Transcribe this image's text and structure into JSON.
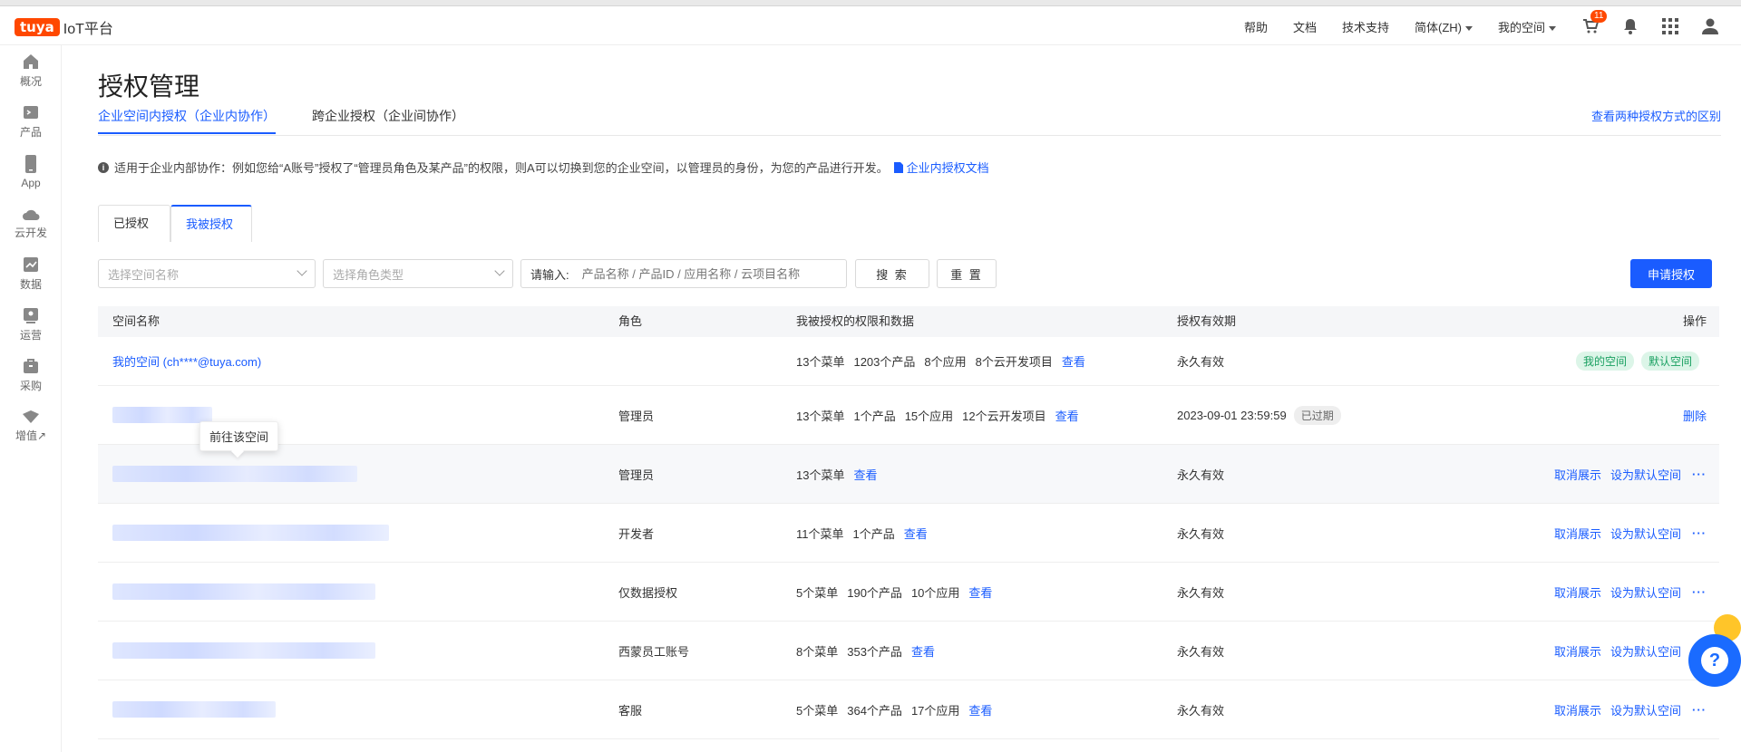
{
  "topbar": {
    "logo_badge": "tuya",
    "logo_text": "IoT平台",
    "nav": [
      "帮助",
      "文档",
      "技术支持",
      "简体(ZH)",
      "我的空间"
    ],
    "cart_count": "11"
  },
  "sidebar": {
    "items": [
      {
        "label": "概况",
        "icon": "home-icon"
      },
      {
        "label": "产品",
        "icon": "product-icon"
      },
      {
        "label": "App",
        "icon": "app-icon"
      },
      {
        "label": "云开发",
        "icon": "cloud-icon"
      },
      {
        "label": "数据",
        "icon": "chart-icon"
      },
      {
        "label": "运营",
        "icon": "operation-icon"
      },
      {
        "label": "采购",
        "icon": "purchase-icon"
      },
      {
        "label": "增值↗",
        "icon": "value-added-icon"
      }
    ]
  },
  "page": {
    "title": "授权管理",
    "tabs": [
      "企业空间内授权（企业内协作）",
      "跨企业授权（企业间协作）"
    ],
    "compare_link": "查看两种授权方式的区别",
    "notice": "适用于企业内部协作：例如您给“A账号”授权了“管理员角色及某产品”的权限，则A可以切换到您的企业空间，以管理员的身份，为您的产品进行开发。",
    "notice_link": "企业内授权文档",
    "subtabs": [
      "已授权",
      "我被授权"
    ]
  },
  "filters": {
    "space_placeholder": "选择空间名称",
    "role_placeholder": "选择角色类型",
    "input_label": "请输入:",
    "input_placeholder": "产品名称 / 产品ID / 应用名称 / 云项目名称",
    "search": "搜 索",
    "reset": "重 置",
    "apply": "申请授权"
  },
  "table": {
    "headers": [
      "空间名称",
      "角色",
      "我被授权的权限和数据",
      "授权有效期",
      "操作"
    ],
    "first_row": {
      "name": "我的空间 (ch****@tuya.com)",
      "perms": [
        "13个菜单",
        "1203个产品",
        "8个应用",
        "8个云开发项目"
      ],
      "view": "查看",
      "validity": "永久有效",
      "tags": [
        "我的空间",
        "默认空间"
      ]
    },
    "expired_row": {
      "role": "管理员",
      "perms": [
        "13个菜单",
        "1个产品",
        "15个应用",
        "12个云开发项目"
      ],
      "view": "查看",
      "validity": "2023-09-01 23:59:59",
      "status": "已过期",
      "op": "删除"
    },
    "rows": [
      {
        "role": "管理员",
        "perms": [
          "13个菜单"
        ],
        "view": "查看",
        "validity": "永久有效"
      },
      {
        "role": "开发者",
        "perms": [
          "11个菜单",
          "1个产品"
        ],
        "view": "查看",
        "validity": "永久有效"
      },
      {
        "role": "仅数据授权",
        "perms": [
          "5个菜单",
          "190个产品",
          "10个应用"
        ],
        "view": "查看",
        "validity": "永久有效"
      },
      {
        "role": "西蒙员工账号",
        "perms": [
          "8个菜单",
          "353个产品"
        ],
        "view": "查看",
        "validity": "永久有效"
      },
      {
        "role": "客服",
        "perms": [
          "5个菜单",
          "364个产品",
          "17个应用"
        ],
        "view": "查看",
        "validity": "永久有效"
      }
    ],
    "op_cancel": "取消展示",
    "op_default": "设为默认空间",
    "op_more": "···"
  },
  "tooltip": "前往该空间",
  "colors": {
    "brand": "#ff4800",
    "primary": "#1a5cff"
  }
}
